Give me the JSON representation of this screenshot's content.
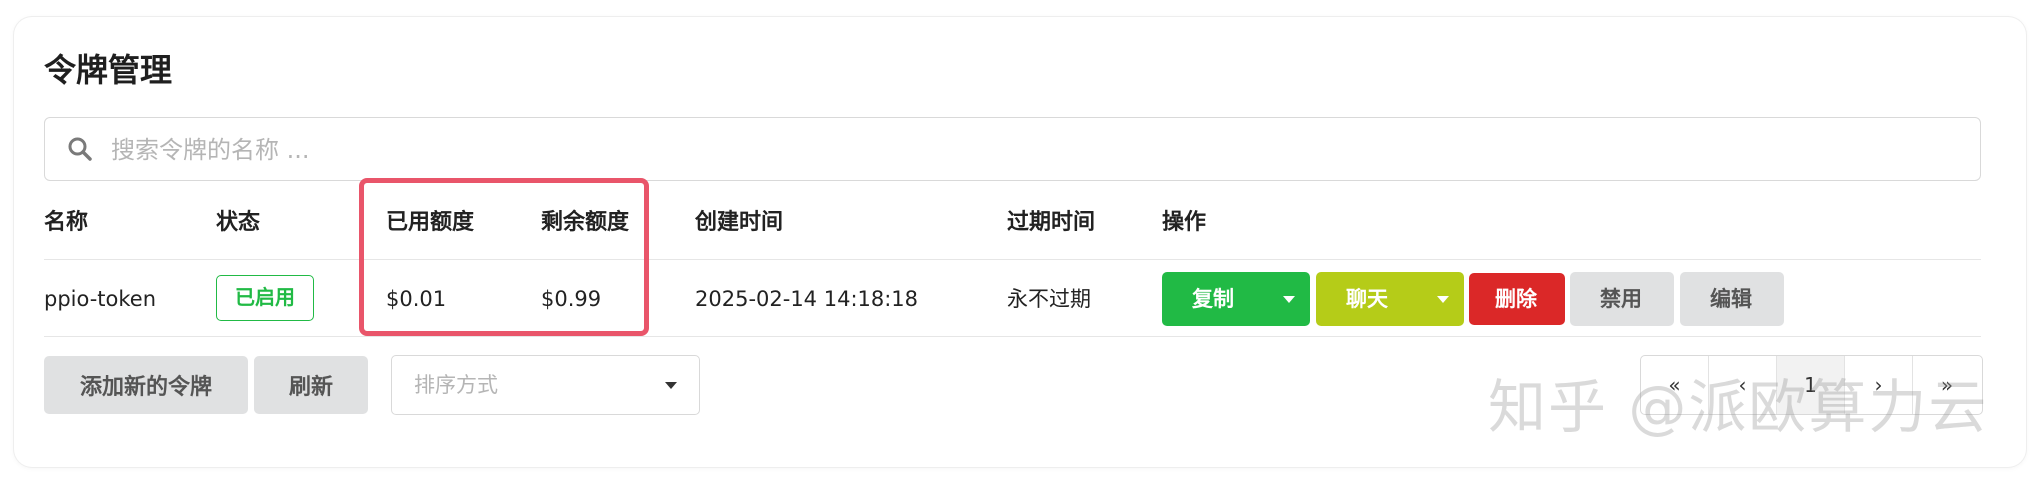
{
  "page": {
    "title": "令牌管理",
    "watermark": "知乎 @派欧算力云"
  },
  "search": {
    "placeholder": "搜索令牌的名称 ...",
    "value": "",
    "icon": "search-icon"
  },
  "table": {
    "headers": [
      "名称",
      "状态",
      "已用额度",
      "剩余额度",
      "创建时间",
      "过期时间",
      "操作"
    ],
    "rows": [
      {
        "name": "ppio-token",
        "status": "已启用",
        "used": "$0.01",
        "remaining": "$0.99",
        "created": "2025-02-14 14:18:18",
        "expires": "永不过期",
        "actions": {
          "copy": "复制",
          "chat": "聊天",
          "delete": "删除",
          "disable": "禁用",
          "edit": "编辑"
        }
      }
    ]
  },
  "footer": {
    "add_label": "添加新的令牌",
    "refresh_label": "刷新",
    "sort_placeholder": "排序方式"
  },
  "pagination": {
    "first": "«",
    "prev": "‹",
    "current": "1",
    "next": "›",
    "last": "»"
  },
  "colors": {
    "green": "#21ba45",
    "olive": "#b5cc18",
    "red": "#db2828",
    "grey": "#e0e1e2",
    "highlight": "#e9556a"
  }
}
